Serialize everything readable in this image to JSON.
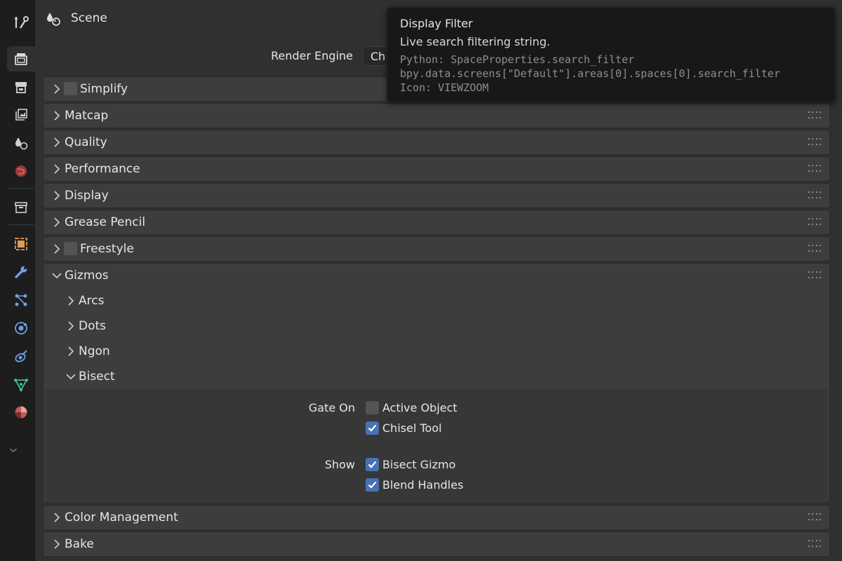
{
  "header": {
    "title": "Scene",
    "icon": "scene-icon"
  },
  "tabs": [
    {
      "name": "tool",
      "icon": "tool-icon",
      "active": false
    },
    {
      "name": "render",
      "icon": "render-icon",
      "active": true
    },
    {
      "name": "output",
      "icon": "output-icon",
      "active": false
    },
    {
      "name": "view-layer",
      "icon": "view-layer-icon",
      "active": false
    },
    {
      "name": "scene",
      "icon": "scene-icon",
      "active": false
    },
    {
      "name": "world",
      "icon": "world-icon",
      "active": false
    },
    {
      "name": "collection",
      "icon": "collection-icon",
      "active": false
    },
    {
      "name": "object",
      "icon": "object-icon",
      "active": false
    },
    {
      "name": "modifiers",
      "icon": "wrench-icon",
      "active": false
    },
    {
      "name": "particles",
      "icon": "particles-icon",
      "active": false
    },
    {
      "name": "physics",
      "icon": "physics-icon",
      "active": false
    },
    {
      "name": "constraints",
      "icon": "constraints-icon",
      "active": false
    },
    {
      "name": "data",
      "icon": "mesh-data-icon",
      "active": false
    },
    {
      "name": "material",
      "icon": "material-icon",
      "active": false
    }
  ],
  "render_engine": {
    "label": "Render Engine",
    "value": "Ch"
  },
  "panels": {
    "simplify": "Simplify",
    "matcap": "Matcap",
    "quality": "Quality",
    "performance": "Performance",
    "display": "Display",
    "grease_pencil": "Grease Pencil",
    "freestyle": "Freestyle",
    "gizmos": "Gizmos",
    "color_management": "Color Management",
    "bake": "Bake"
  },
  "gizmos": {
    "subpanels": {
      "arcs": "Arcs",
      "dots": "Dots",
      "ngon": "Ngon",
      "bisect": "Bisect"
    },
    "bisect": {
      "gate_on_label": "Gate On",
      "active_object": {
        "label": "Active Object",
        "checked": false
      },
      "chisel_tool": {
        "label": "Chisel Tool",
        "checked": true
      },
      "show_label": "Show",
      "bisect_gizmo": {
        "label": "Bisect Gizmo",
        "checked": true
      },
      "blend_handles": {
        "label": "Blend Handles",
        "checked": true
      }
    }
  },
  "tooltip": {
    "title": "Display Filter",
    "description": "Live search filtering string.",
    "python": "Python: SpaceProperties.search_filter",
    "path": "bpy.data.screens[\"Default\"].areas[0].spaces[0].search_filter",
    "icon": "Icon: VIEWZOOM"
  },
  "colors": {
    "accent": "#4772b3",
    "panel": "#3d3d3d",
    "background": "#303030",
    "tabstrip": "#1d1d1d",
    "tooltip": "#181818"
  }
}
